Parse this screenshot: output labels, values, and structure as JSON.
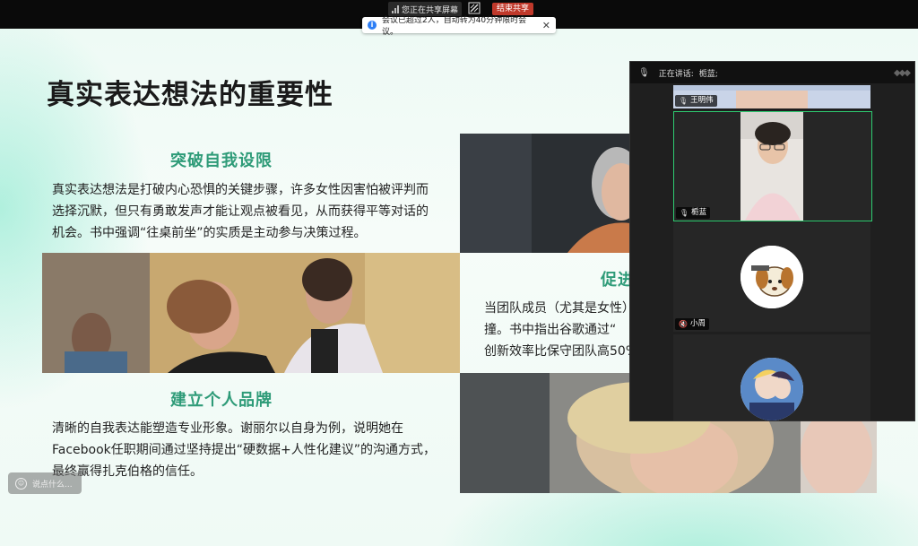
{
  "share_bar": {
    "status_text": "您正在共享屏幕",
    "stop_label": "结束共享",
    "annotate_icon": "annotate-icon"
  },
  "notice": {
    "text": "会议已超过2人，自动转为40分钟限时会议。",
    "close": "✕",
    "icon": "i"
  },
  "slide": {
    "title": "真实表达想法的重要性",
    "sections": [
      {
        "heading": "突破自我设限",
        "lines": [
          "真实表达想法是打破内心恐惧的关键步骤，许多女性因害怕被评判而",
          "选择沉默，但只有勇敢发声才能让观点被看见，从而获得平等对话的",
          "机会。书中强调“往桌前坐”的实质是主动参与决策过程。"
        ]
      },
      {
        "heading": "促进",
        "lines": [
          "当团队成员（尤其是女性）",
          "撞。书中指出谷歌通过“",
          "创新效率比保守团队高50%"
        ]
      },
      {
        "heading": "建立个人品牌",
        "lines": [
          "清晰的自我表达能塑造专业形象。谢丽尔以自身为例，说明她在",
          "Facebook任职期间通过坚持提出“硬数据+人性化建议”的沟通方式，",
          "最终赢得扎克伯格的信任。"
        ]
      }
    ]
  },
  "chat_input": {
    "placeholder": "说点什么..."
  },
  "video_panel": {
    "speaking_label": "正在讲话:",
    "speaker_name": "栀蓝;",
    "participants": [
      {
        "name": "王明伟",
        "mic": "🎙"
      },
      {
        "name": "栀蓝",
        "mic": "🎙"
      },
      {
        "name": "小周",
        "mic": "🔇"
      },
      {
        "name": "",
        "mic": ""
      }
    ]
  },
  "colors": {
    "accent_green": "#2e9b78",
    "active_border": "#2ecc71",
    "stop_red": "#c0392b"
  }
}
